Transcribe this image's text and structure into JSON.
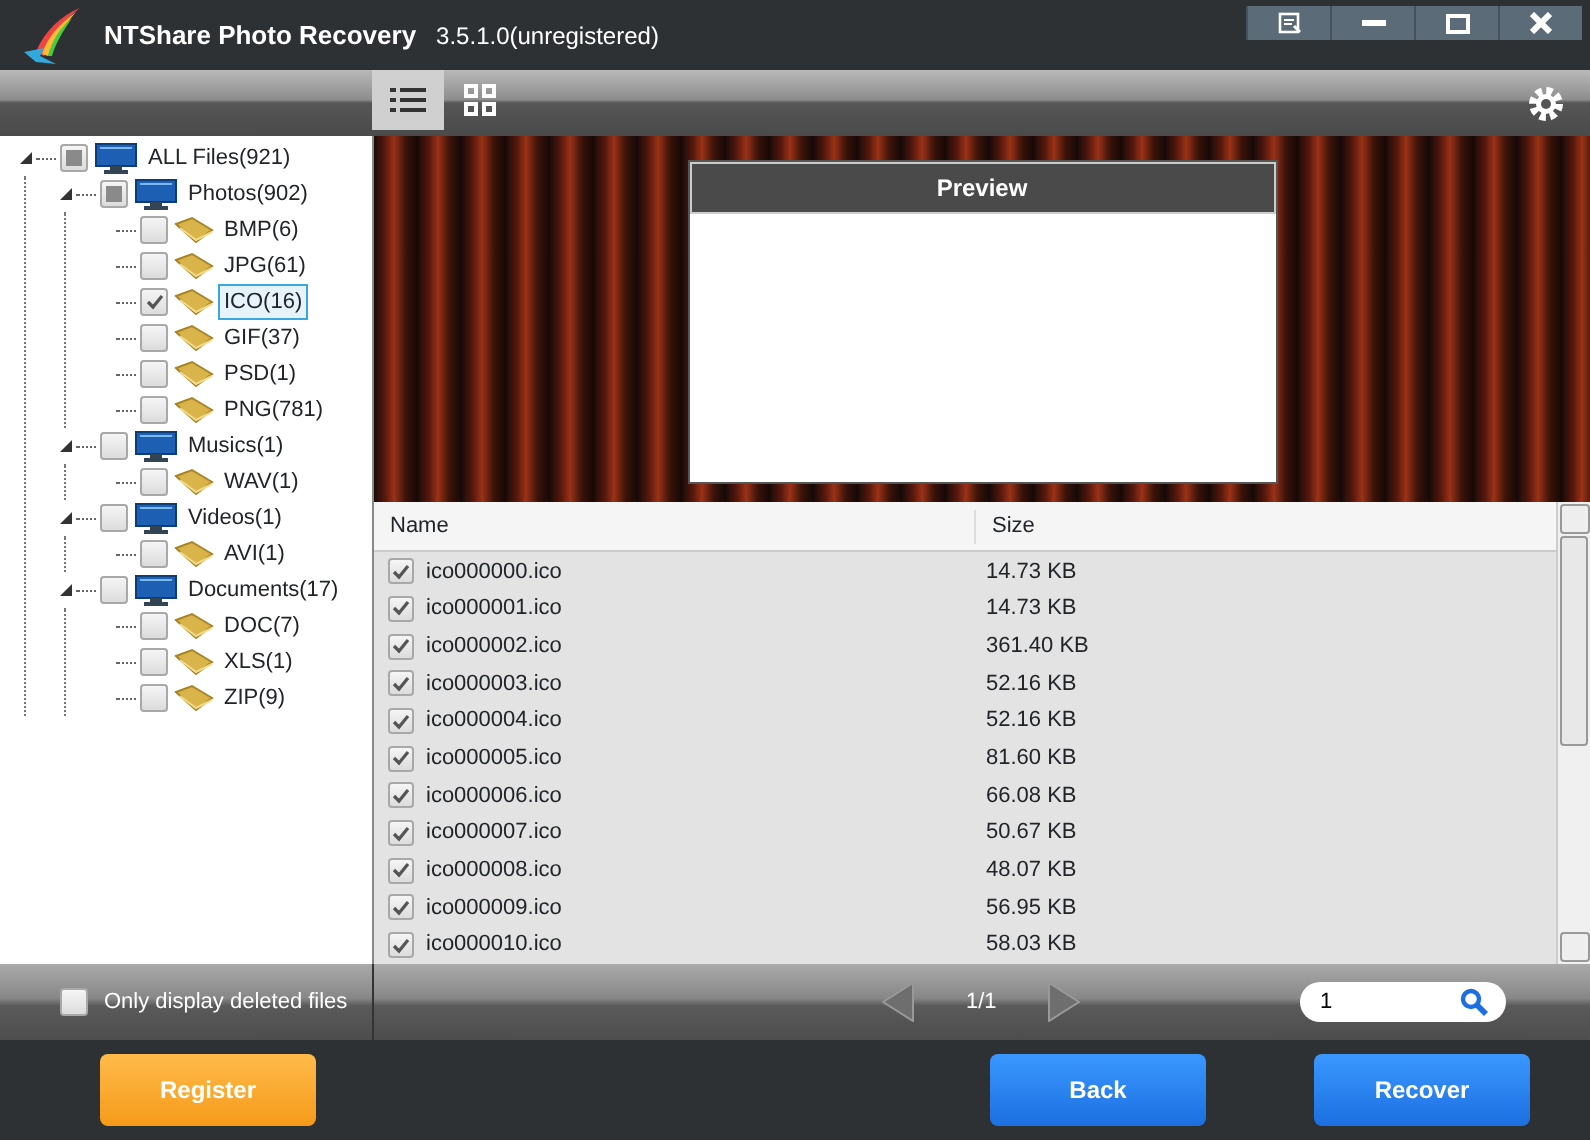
{
  "window": {
    "title": "NTShare Photo Recovery",
    "version": "3.5.1.0(unregistered)"
  },
  "view_toggle": [
    {
      "kind": "list",
      "selected": true
    },
    {
      "kind": "grid",
      "selected": false
    }
  ],
  "tree": [
    {
      "label": "ALL Files(921)",
      "kind": "category",
      "checked": false,
      "partial": true,
      "selected": false,
      "expanded": true,
      "children": [
        {
          "label": "Photos(902)",
          "kind": "category",
          "checked": false,
          "partial": true,
          "selected": false,
          "expanded": true,
          "children": [
            {
              "label": "BMP(6)",
              "kind": "folder",
              "checked": false,
              "selected": false
            },
            {
              "label": "JPG(61)",
              "kind": "folder",
              "checked": false,
              "selected": false
            },
            {
              "label": "ICO(16)",
              "kind": "folder",
              "checked": true,
              "selected": true
            },
            {
              "label": "GIF(37)",
              "kind": "folder",
              "checked": false,
              "selected": false
            },
            {
              "label": "PSD(1)",
              "kind": "folder",
              "checked": false,
              "selected": false
            },
            {
              "label": "PNG(781)",
              "kind": "folder",
              "checked": false,
              "selected": false
            }
          ]
        },
        {
          "label": "Musics(1)",
          "kind": "category",
          "checked": false,
          "partial": false,
          "selected": false,
          "expanded": true,
          "children": [
            {
              "label": "WAV(1)",
              "kind": "folder",
              "checked": false,
              "selected": false
            }
          ]
        },
        {
          "label": "Videos(1)",
          "kind": "category",
          "checked": false,
          "partial": false,
          "selected": false,
          "expanded": true,
          "children": [
            {
              "label": "AVI(1)",
              "kind": "folder",
              "checked": false,
              "selected": false
            }
          ]
        },
        {
          "label": "Documents(17)",
          "kind": "category",
          "checked": false,
          "partial": false,
          "selected": false,
          "expanded": true,
          "children": [
            {
              "label": "DOC(7)",
              "kind": "folder",
              "checked": false,
              "selected": false
            },
            {
              "label": "XLS(1)",
              "kind": "folder",
              "checked": false,
              "selected": false
            },
            {
              "label": "ZIP(9)",
              "kind": "folder",
              "checked": false,
              "selected": false
            }
          ]
        }
      ]
    }
  ],
  "preview": {
    "title": "Preview"
  },
  "table": {
    "columns": [
      "Name",
      "Size"
    ],
    "rows": [
      {
        "name": "ico000000.ico",
        "size": "14.73 KB",
        "checked": true
      },
      {
        "name": "ico000001.ico",
        "size": "14.73 KB",
        "checked": true
      },
      {
        "name": "ico000002.ico",
        "size": "361.40 KB",
        "checked": true
      },
      {
        "name": "ico000003.ico",
        "size": "52.16 KB",
        "checked": true
      },
      {
        "name": "ico000004.ico",
        "size": "52.16 KB",
        "checked": true
      },
      {
        "name": "ico000005.ico",
        "size": "81.60 KB",
        "checked": true
      },
      {
        "name": "ico000006.ico",
        "size": "66.08 KB",
        "checked": true
      },
      {
        "name": "ico000007.ico",
        "size": "50.67 KB",
        "checked": true
      },
      {
        "name": "ico000008.ico",
        "size": "48.07 KB",
        "checked": true
      },
      {
        "name": "ico000009.ico",
        "size": "56.95 KB",
        "checked": true
      },
      {
        "name": "ico000010.ico",
        "size": "58.03 KB",
        "checked": true
      }
    ]
  },
  "deleted_filter": {
    "label": "Only display deleted files",
    "checked": false
  },
  "pager": {
    "text": "1/1",
    "prev_disabled": true,
    "next_disabled": true
  },
  "page_search": {
    "value": "1"
  },
  "buttons": [
    {
      "label": "Register",
      "kind": "orange"
    },
    {
      "label": "Back",
      "kind": "blue"
    },
    {
      "label": "Recover",
      "kind": "blue"
    }
  ]
}
